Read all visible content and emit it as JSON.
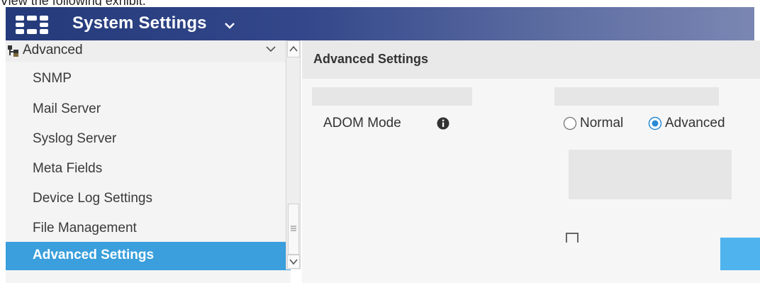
{
  "caption": "View the following exhibit.",
  "app": {
    "title": "System Settings",
    "title_icon": "grid-icon",
    "dropdown_icon": "chevron-down-icon"
  },
  "sidebar": {
    "section": {
      "label": "Advanced",
      "icon": "folder-tree-icon",
      "collapse_icon": "chevron-down-icon"
    },
    "items": [
      {
        "label": "SNMP",
        "active": false
      },
      {
        "label": "Mail Server",
        "active": false
      },
      {
        "label": "Syslog Server",
        "active": false
      },
      {
        "label": "Meta Fields",
        "active": false
      },
      {
        "label": "Device Log Settings",
        "active": false
      },
      {
        "label": "File Management",
        "active": false
      },
      {
        "label": "Advanced Settings",
        "active": true
      }
    ]
  },
  "main": {
    "title": "Advanced Settings",
    "adom_mode": {
      "label": "ADOM Mode",
      "info_icon": "info-icon",
      "options": [
        "Normal",
        "Advanced"
      ],
      "selected": "Advanced"
    }
  },
  "colors": {
    "topbar": "#243a7a",
    "active_item": "#3a9fdc",
    "radio_selected": "#2a8ad4",
    "button": "#4fb3ee"
  }
}
